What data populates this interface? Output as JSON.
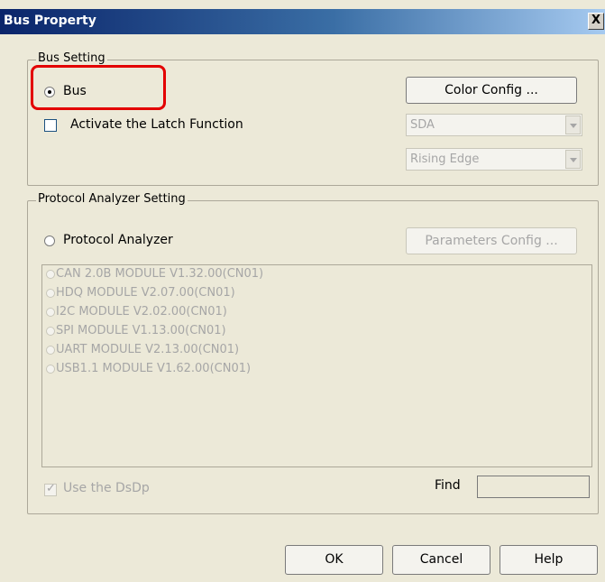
{
  "window": {
    "title": "Bus Property",
    "close_label": "X"
  },
  "bus_setting": {
    "legend": "Bus Setting",
    "bus_label": "Bus",
    "color_config_label": "Color Config ...",
    "latch_label": "Activate the Latch Function",
    "signal_select": "SDA",
    "edge_select": "Rising Edge"
  },
  "protocol_setting": {
    "legend": "Protocol Analyzer Setting",
    "analyzer_label": "Protocol Analyzer",
    "parameters_label": "Parameters Config ...",
    "modules": [
      "CAN 2.0B MODULE V1.32.00(CN01)",
      "HDQ MODULE V2.07.00(CN01)",
      "I2C MODULE V2.02.00(CN01)",
      "SPI MODULE V1.13.00(CN01)",
      "UART MODULE V2.13.00(CN01)",
      "USB1.1 MODULE V1.62.00(CN01)"
    ],
    "dsdp_label": "Use the DsDp",
    "find_label": "Find",
    "find_value": ""
  },
  "footer": {
    "ok_label": "OK",
    "cancel_label": "Cancel",
    "help_label": "Help"
  },
  "colors": {
    "title_start": "#0a246a",
    "title_end": "#a6caf0",
    "highlight": "#e30000",
    "dialog_bg": "#ece9d8"
  }
}
